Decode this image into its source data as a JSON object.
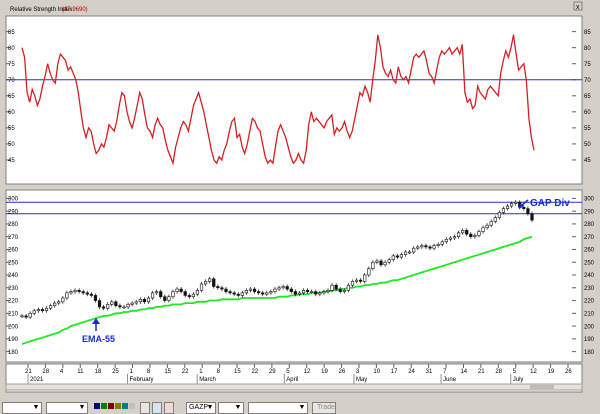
{
  "indicator_title": "Relative Strength Index",
  "indicator_value": "(47.9690)",
  "chart_data": [
    {
      "type": "line",
      "name": "rsi-panel",
      "title": "Relative Strength Index",
      "ylim": [
        40,
        88
      ],
      "yticks": [
        45,
        50,
        55,
        60,
        65,
        70,
        75,
        80,
        85
      ],
      "reference_line": 70,
      "color": "#d42020",
      "values": [
        80,
        77,
        66,
        63,
        67,
        65,
        62,
        64,
        68,
        71,
        75,
        72,
        70,
        69,
        75,
        78,
        77,
        76,
        73,
        74,
        72,
        70,
        66,
        60,
        55,
        52,
        55,
        54,
        50,
        47,
        48,
        50,
        49,
        52,
        56,
        55,
        54,
        57,
        62,
        66,
        65,
        60,
        57,
        55,
        58,
        62,
        66,
        64,
        59,
        55,
        54,
        52,
        56,
        58,
        56,
        55,
        51,
        48,
        46,
        44,
        49,
        52,
        55,
        57,
        56,
        54,
        58,
        62,
        64,
        66,
        63,
        60,
        56,
        52,
        48,
        45,
        44,
        46,
        45,
        48,
        50,
        54,
        57,
        58,
        52,
        53,
        49,
        47,
        50,
        54,
        58,
        57,
        55,
        54,
        50,
        46,
        44,
        45,
        44,
        49,
        54,
        56,
        54,
        52,
        49,
        46,
        44,
        45,
        47,
        45,
        44,
        48,
        56,
        60,
        57,
        58,
        57,
        56,
        55,
        57,
        58,
        59,
        53,
        55,
        54,
        55,
        57,
        54,
        52,
        54,
        58,
        62,
        66,
        65,
        68,
        66,
        63,
        70,
        76,
        84,
        80,
        74,
        72,
        71,
        73,
        70,
        69,
        74,
        71,
        70,
        71,
        69,
        73,
        77,
        78,
        77,
        78,
        79,
        76,
        72,
        71,
        69,
        73,
        77,
        79,
        78,
        79,
        80,
        78,
        79,
        80,
        78,
        81,
        66,
        63,
        64,
        61,
        62,
        68,
        66,
        65,
        64,
        67,
        68,
        67,
        66,
        65,
        72,
        76,
        79,
        77,
        80,
        84,
        78,
        73,
        74,
        75,
        70,
        58,
        52,
        48
      ]
    },
    {
      "type": "line",
      "name": "price-panel",
      "ylim": [
        175,
        305
      ],
      "yticks": [
        180,
        190,
        200,
        210,
        220,
        230,
        240,
        250,
        260,
        270,
        280,
        290,
        300
      ],
      "reference_lines": [
        288,
        297
      ],
      "price_color": "#111111",
      "ema_color": "#1ee81e",
      "series": [
        {
          "name": "EMA-55",
          "values": [
            186,
            187,
            188,
            189,
            190,
            191,
            192,
            193,
            194,
            195,
            197,
            198,
            200,
            201,
            202,
            203,
            204,
            205,
            206,
            207,
            208,
            208,
            209,
            210,
            210,
            211,
            211,
            212,
            212,
            213,
            213,
            214,
            214,
            215,
            215,
            216,
            216,
            217,
            217,
            217,
            218,
            218,
            218,
            219,
            219,
            219,
            220,
            220,
            220,
            221,
            221,
            221,
            221,
            221,
            222,
            222,
            222,
            222,
            222,
            222,
            222,
            222,
            222,
            223,
            223,
            223,
            224,
            224,
            225,
            225,
            225,
            226,
            226,
            226,
            227,
            227,
            228,
            228,
            229,
            229,
            230,
            230,
            231,
            231,
            232,
            232,
            233,
            233,
            234,
            234,
            235,
            236,
            236,
            237,
            238,
            239,
            240,
            241,
            242,
            243,
            244,
            245,
            246,
            247,
            248,
            249,
            250,
            251,
            252,
            253,
            254,
            255,
            256,
            257,
            258,
            259,
            260,
            261,
            262,
            263,
            264,
            265,
            266,
            268,
            269,
            270
          ]
        },
        {
          "name": "Price",
          "values": [
            208,
            207,
            210,
            212,
            213,
            212,
            214,
            216,
            218,
            219,
            222,
            226,
            227,
            228,
            227,
            226,
            225,
            224,
            220,
            215,
            214,
            217,
            219,
            216,
            215,
            215,
            217,
            218,
            219,
            221,
            219,
            222,
            226,
            227,
            223,
            220,
            223,
            227,
            229,
            227,
            224,
            223,
            225,
            228,
            233,
            235,
            237,
            231,
            230,
            229,
            227,
            226,
            225,
            224,
            226,
            228,
            229,
            227,
            226,
            225,
            226,
            227,
            229,
            230,
            231,
            229,
            227,
            225,
            226,
            228,
            227,
            227,
            225,
            226,
            227,
            228,
            232,
            229,
            227,
            228,
            232,
            235,
            236,
            235,
            240,
            245,
            250,
            251,
            248,
            250,
            252,
            255,
            254,
            256,
            258,
            258,
            261,
            262,
            263,
            262,
            261,
            263,
            264,
            266,
            268,
            269,
            270,
            273,
            275,
            272,
            270,
            271,
            274,
            277,
            279,
            282,
            285,
            289,
            292,
            294,
            296,
            297,
            293,
            292,
            288,
            283
          ]
        }
      ],
      "annotations": [
        "GAP Div",
        "EMA-55"
      ]
    }
  ],
  "x_axis": {
    "tick_labels": [
      "21",
      "28",
      "4",
      "11",
      "18",
      "25",
      "1",
      "8",
      "15",
      "22",
      "1",
      "8",
      "15",
      "22",
      "29",
      "5",
      "12",
      "19",
      "26",
      "3",
      "10",
      "17",
      "24",
      "31",
      "7",
      "14",
      "21",
      "28",
      "5",
      "12",
      "19",
      "26"
    ],
    "period_labels": [
      "2021",
      "February",
      "March",
      "April",
      "May",
      "June",
      "July"
    ]
  },
  "toolbar": {
    "symbol": "GAZP",
    "trade_label": "Trade"
  }
}
